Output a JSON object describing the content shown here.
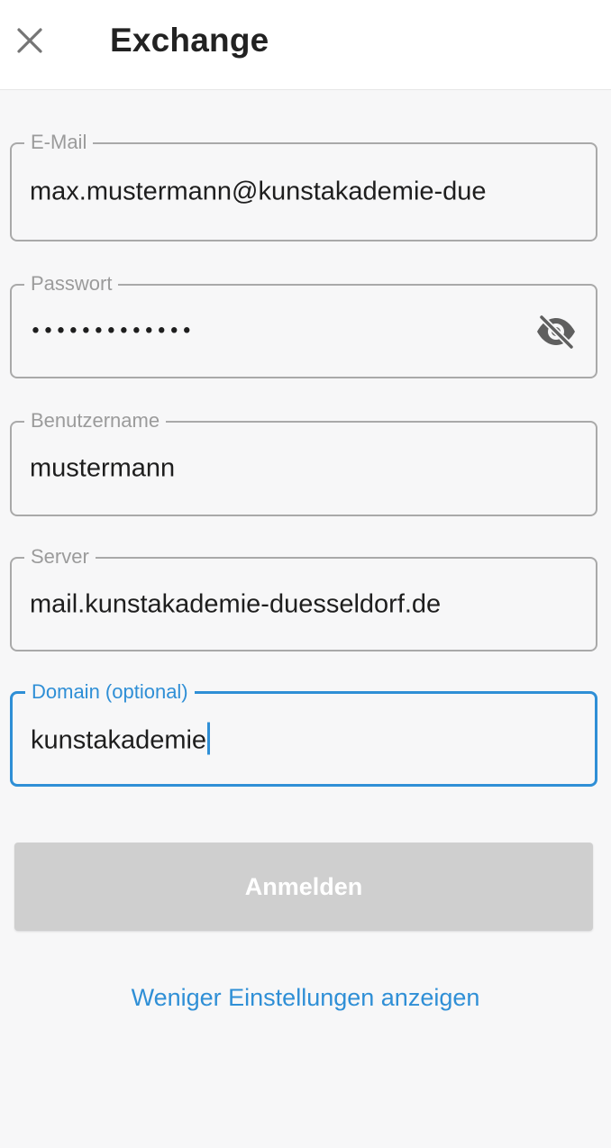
{
  "header": {
    "title": "Exchange",
    "close_icon": "close-icon"
  },
  "form": {
    "email": {
      "label": "E-Mail",
      "value": "max.mustermann@kunstakademie-due"
    },
    "password": {
      "label": "Passwort",
      "masked_value": "•••••••••••••",
      "toggle_icon": "eye-off-icon"
    },
    "username": {
      "label": "Benutzername",
      "value": "mustermann"
    },
    "server": {
      "label": "Server",
      "value": "mail.kunstakademie-duesseldorf.de"
    },
    "domain": {
      "label": "Domain (optional)",
      "value": "kunstakademie",
      "focused": true
    }
  },
  "actions": {
    "login_label": "Anmelden",
    "toggle_settings_label": "Weniger Einstellungen anzeigen"
  },
  "colors": {
    "accent": "#2f8fd6",
    "button_disabled": "#cfcfcf",
    "field_border": "#a9a9a9",
    "background": "#f7f7f8"
  }
}
